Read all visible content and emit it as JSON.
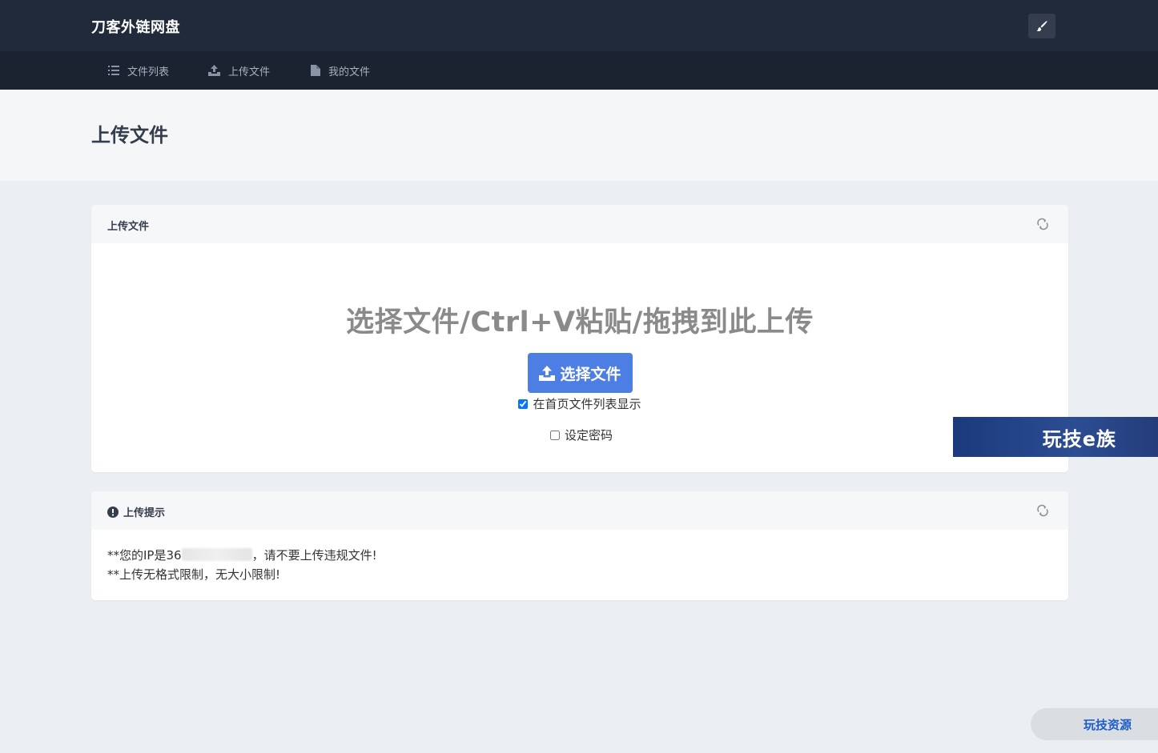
{
  "app": {
    "title": "刀客外链网盘"
  },
  "nav": {
    "items": [
      {
        "label": "文件列表",
        "icon": "list-icon"
      },
      {
        "label": "上传文件",
        "icon": "upload-icon"
      },
      {
        "label": "我的文件",
        "icon": "file-icon"
      }
    ]
  },
  "page": {
    "title": "上传文件"
  },
  "upload_card": {
    "title": "上传文件",
    "drop_text": "选择文件/Ctrl+V粘贴/拖拽到此上传",
    "select_button": "选择文件",
    "show_on_homepage": {
      "label": "在首页文件列表显示",
      "checked": true
    },
    "set_password": {
      "label": "设定密码",
      "checked": false
    }
  },
  "tips_card": {
    "title": "上传提示",
    "line1_prefix": "**您的IP是36",
    "line1_suffix": "，请不要上传违规文件!",
    "line2": "**上传无格式限制，无大小限制!"
  },
  "watermarks": {
    "badge1": "玩技e族",
    "badge2": "玩技资源"
  },
  "colors": {
    "topbar": "#202a3b",
    "navbar": "#1b2230",
    "primary_button": "#4d7ee3",
    "background": "#ebeef2"
  }
}
